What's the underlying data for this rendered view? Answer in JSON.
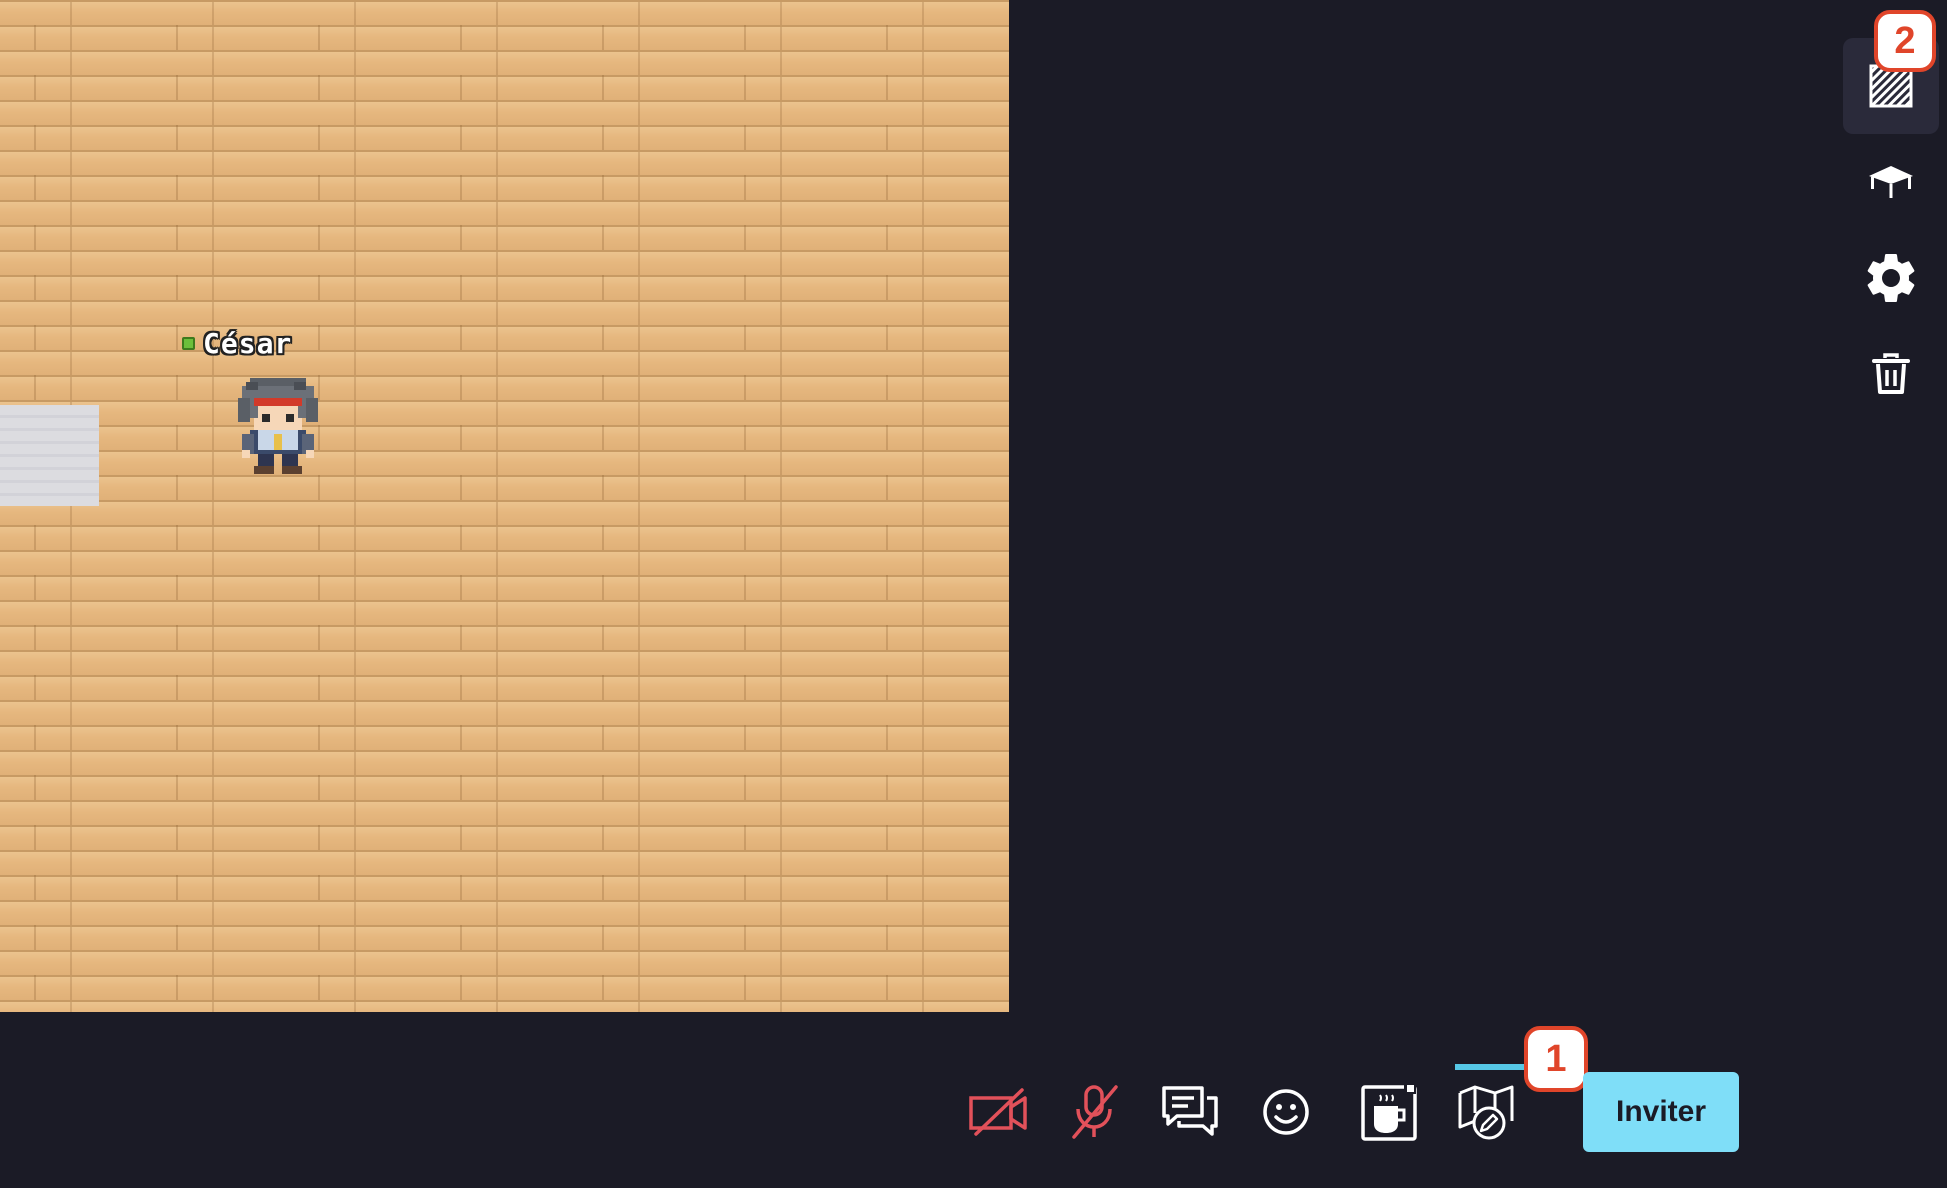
{
  "map": {
    "player": {
      "name": "César",
      "status_color": "#6bbf3b"
    }
  },
  "side_menu": {
    "items": [
      {
        "name": "layers",
        "icon": "hatched-square-icon",
        "active": true
      },
      {
        "name": "platform",
        "icon": "table-icon",
        "active": false
      },
      {
        "name": "settings",
        "icon": "gear-icon",
        "active": false
      },
      {
        "name": "delete",
        "icon": "trash-icon",
        "active": false
      }
    ],
    "badge": "2"
  },
  "action_bar": {
    "items": [
      {
        "name": "camera",
        "icon": "camera-off-icon",
        "color": "#e2515a"
      },
      {
        "name": "microphone",
        "icon": "microphone-off-icon",
        "color": "#e2515a"
      },
      {
        "name": "chat",
        "icon": "chat-icon",
        "color": "#ffffff"
      },
      {
        "name": "emoji",
        "icon": "smiley-icon",
        "color": "#ffffff"
      },
      {
        "name": "break",
        "icon": "coffee-cup-icon",
        "color": "#ffffff"
      },
      {
        "name": "map-editor",
        "icon": "map-edit-icon",
        "color": "#ffffff"
      }
    ],
    "badge": "1",
    "invite_label": "Inviter"
  },
  "colors": {
    "background": "#1b1b26",
    "accent": "#7fdef8",
    "badge": "#e0452a"
  }
}
